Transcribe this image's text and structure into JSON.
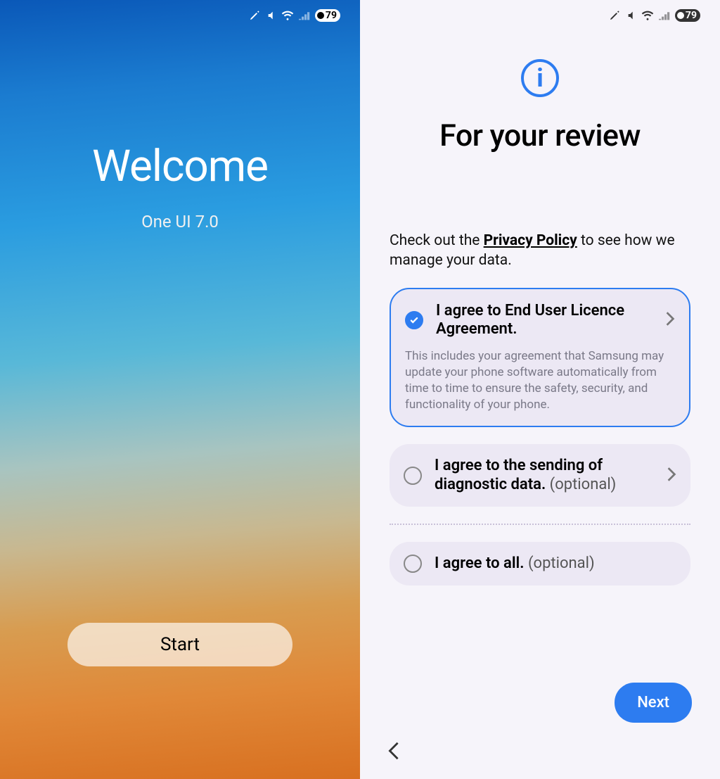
{
  "status": {
    "battery": "79"
  },
  "left": {
    "title": "Welcome",
    "subtitle": "One UI 7.0",
    "start": "Start"
  },
  "right": {
    "info_glyph": "i",
    "title": "For your review",
    "privacy_pre": "Check out the ",
    "privacy_link": "Privacy Policy",
    "privacy_post": " to see how we manage your data.",
    "agreements": [
      {
        "label": "I agree to End User Licence Agreement.",
        "optional": "",
        "desc": "This includes your agreement that Samsung may update your phone software automatically from time to time to ensure the safety, security, and functionality of your phone.",
        "checked": true
      },
      {
        "label": "I agree to the sending of diagnostic data. ",
        "optional": "(optional)",
        "desc": "",
        "checked": false
      },
      {
        "label": "I agree to all. ",
        "optional": "(optional)",
        "desc": "",
        "checked": false
      }
    ],
    "next": "Next"
  }
}
